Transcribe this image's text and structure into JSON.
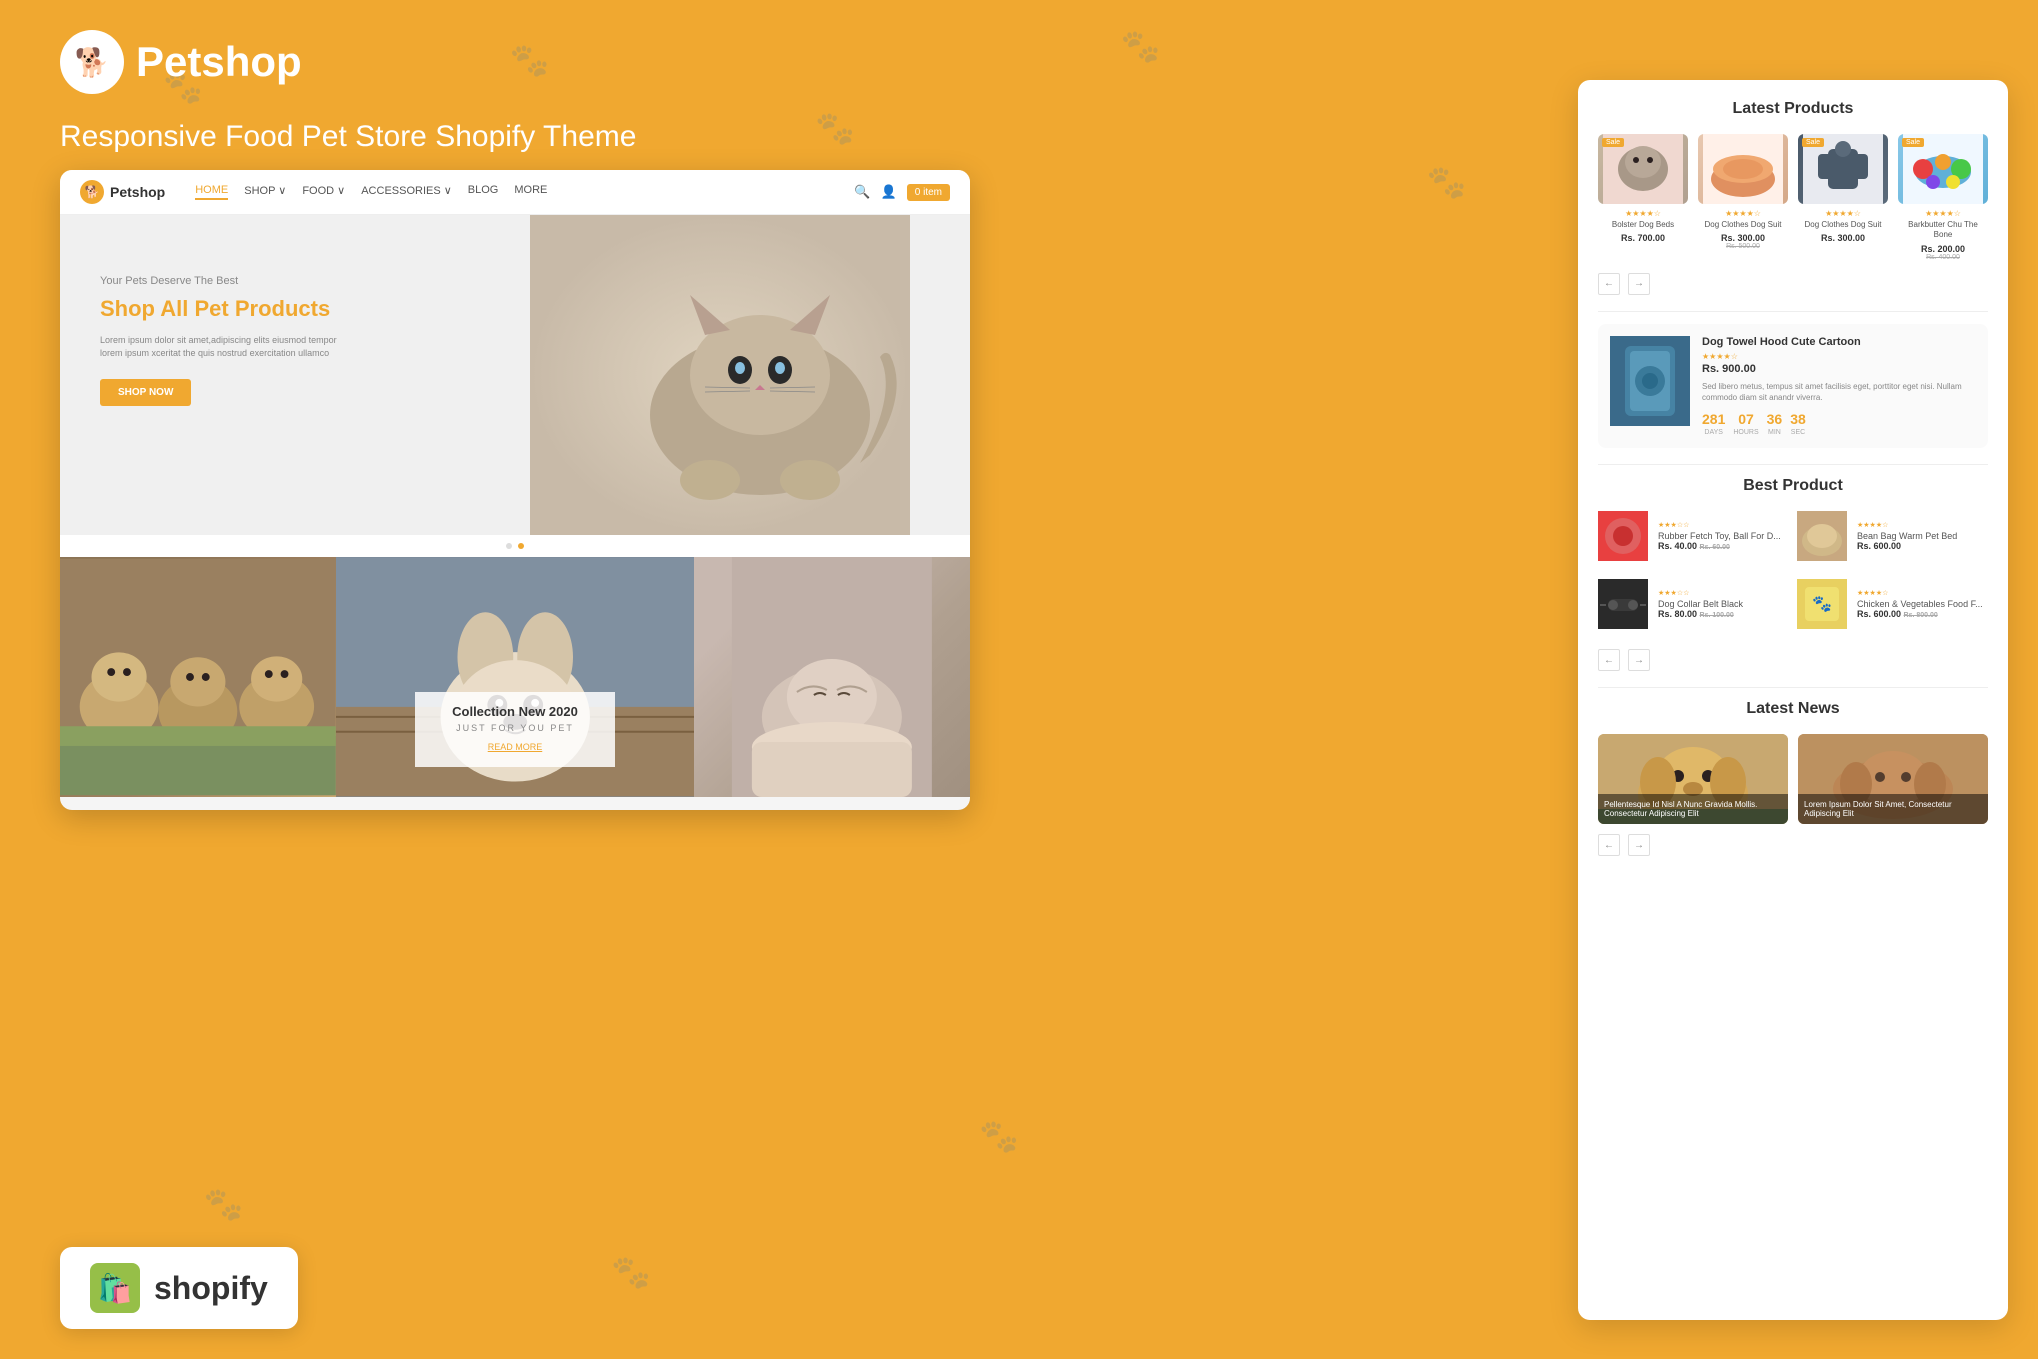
{
  "brand": {
    "name": "Petshop",
    "tagline": "Responsive Food Pet Store Shopify Theme"
  },
  "nav": {
    "logo": "Petshop",
    "links": [
      "HOME",
      "SHOP",
      "FOOD",
      "ACCESSORIES",
      "BLOG",
      "MORE"
    ],
    "active": "HOME",
    "cart": "0 item"
  },
  "hero": {
    "subtitle": "Your Pets Deserve The Best",
    "title": "Shop All Pet Products",
    "description": "Lorem ipsum dolor sit amet,adipiscing elits eiusmod tempor lorem ipsum xceritat the quis nostrud exercitation ullamco",
    "cta": "ShOP Now"
  },
  "collection": {
    "title": "Collection New 2020",
    "subtitle": "JUST FOR YOU PET",
    "link": "READ MORE"
  },
  "shopify": {
    "text": "shopify"
  },
  "latest_products": {
    "section_title": "Latest Products",
    "products": [
      {
        "name": "Bolster Dog Beds",
        "price": "Rs. 700.00",
        "stars": "★★★★☆",
        "sale": "Sale"
      },
      {
        "name": "Dog Clothes Dog Suit",
        "price": "Rs. 300.00",
        "old_price": "Rs. 500.00",
        "stars": "★★★★☆",
        "sale": "Sale"
      },
      {
        "name": "Barkbutter Chu The Bone",
        "price": "Rs. 200.00",
        "old_price": "Rs. 400.00",
        "stars": "★★★★☆",
        "sale": "Sale"
      }
    ]
  },
  "flash_sale": {
    "title": "Dog Towel Hood Cute Cartoon",
    "price": "Rs. 900.00",
    "stars": "★★★★☆",
    "description": "Sed libero metus, tempus sit amet facilisis eget, porttitor eget nisi. Nullam commodo diam sit anandr viverra.",
    "countdown": {
      "days": "281",
      "hours": "07",
      "min": "36",
      "sec": "38"
    }
  },
  "best_products": {
    "section_title": "Best Product",
    "products": [
      {
        "name": "Rubber Fetch Toy, Ball For D...",
        "price": "Rs. 40.00",
        "old_price": "Rs. 60.00",
        "stars": "★★★☆☆"
      },
      {
        "name": "Bean Bag Warm Pet Bed",
        "price": "Rs. 600.00",
        "stars": "★★★★☆"
      },
      {
        "name": "Dog Collar Belt Black",
        "price": "Rs. 80.00",
        "old_price": "Rs. 100.00",
        "stars": "★★★☆☆"
      },
      {
        "name": "Chicken & Vegetables Food F...",
        "price": "Rs. 600.00",
        "old_price": "Rs. 800.00",
        "stars": "★★★★☆"
      }
    ]
  },
  "latest_news": {
    "section_title": "Latest News",
    "articles": [
      {
        "title": "Pellentesque Id Nisl A Nunc Gravida Mollis. Consectetur Adipiscing Elit"
      },
      {
        "title": "Lorem Ipsum Dolor Sit Amet, Consectetur Adipiscing Elit"
      }
    ]
  },
  "arrows": {
    "prev": "←",
    "next": "→"
  }
}
